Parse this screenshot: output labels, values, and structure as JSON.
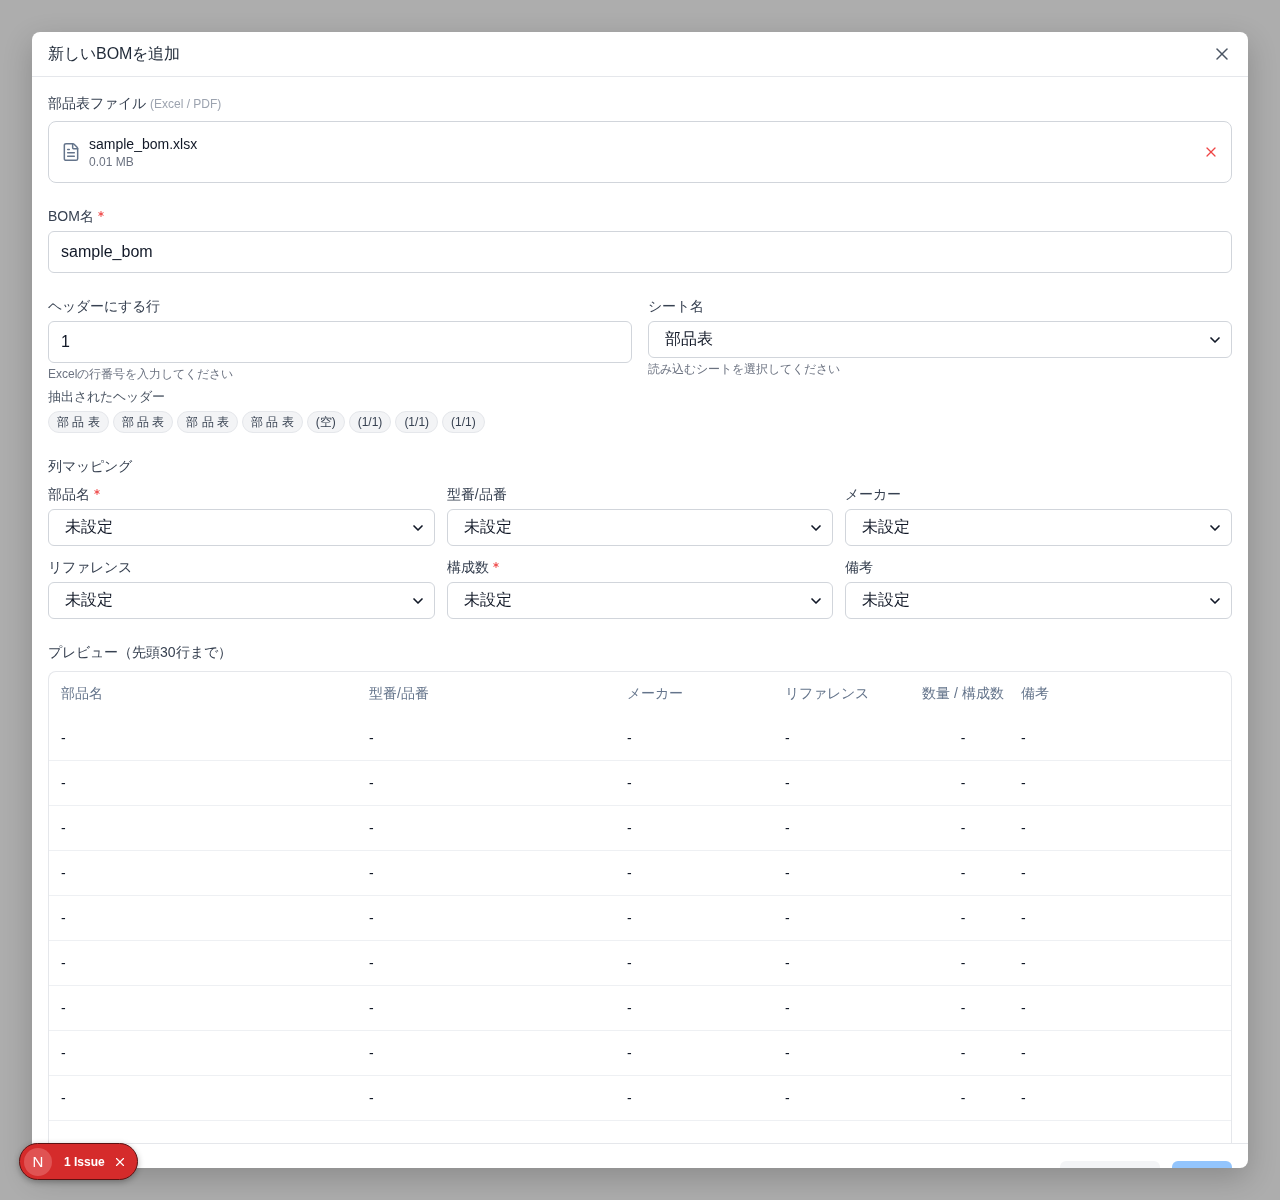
{
  "dialog": {
    "title": "新しいBOMを追加"
  },
  "file_field": {
    "label": "部品表ファイル",
    "hint": "(Excel / PDF)",
    "file": {
      "name": "sample_bom.xlsx",
      "size": "0.01 MB"
    }
  },
  "bom_name": {
    "label": "BOM名",
    "required": true,
    "value": "sample_bom"
  },
  "header_row": {
    "label": "ヘッダーにする行",
    "value": "1",
    "help": "Excelの行番号を入力してください",
    "extracted_label": "抽出されたヘッダー",
    "extracted_headers": [
      "部 品 表",
      "部 品 表",
      "部 品 表",
      "部 品 表",
      "(空)",
      "(1/1)",
      "(1/1)",
      "(1/1)"
    ]
  },
  "sheet": {
    "label": "シート名",
    "value": "部品表",
    "help": "読み込むシートを選択してください"
  },
  "column_mapping": {
    "title": "列マッピング",
    "fields": [
      {
        "label": "部品名",
        "required": true,
        "value": "未設定"
      },
      {
        "label": "型番/品番",
        "required": false,
        "value": "未設定"
      },
      {
        "label": "メーカー",
        "required": false,
        "value": "未設定"
      },
      {
        "label": "リファレンス",
        "required": false,
        "value": "未設定"
      },
      {
        "label": "構成数",
        "required": true,
        "value": "未設定"
      },
      {
        "label": "備考",
        "required": false,
        "value": "未設定"
      }
    ]
  },
  "preview": {
    "title": "プレビュー（先頭30行まで）",
    "columns": [
      "部品名",
      "型番/品番",
      "メーカー",
      "リファレンス",
      "数量 / 構成数",
      "備考"
    ],
    "rows": [
      [
        "-",
        "-",
        "-",
        "-",
        "-",
        "-"
      ],
      [
        "-",
        "-",
        "-",
        "-",
        "-",
        "-"
      ],
      [
        "-",
        "-",
        "-",
        "-",
        "-",
        "-"
      ],
      [
        "-",
        "-",
        "-",
        "-",
        "-",
        "-"
      ],
      [
        "-",
        "-",
        "-",
        "-",
        "-",
        "-"
      ],
      [
        "-",
        "-",
        "-",
        "-",
        "-",
        "-"
      ],
      [
        "-",
        "-",
        "-",
        "-",
        "-",
        "-"
      ],
      [
        "-",
        "-",
        "-",
        "-",
        "-",
        "-"
      ],
      [
        "-",
        "-",
        "-",
        "-",
        "-",
        "-"
      ]
    ]
  },
  "footer": {
    "buttons": [
      {
        "kind": "secondary"
      },
      {
        "kind": "primary"
      }
    ]
  },
  "issues_badge": {
    "logo": "N",
    "label": "1 Issue"
  }
}
